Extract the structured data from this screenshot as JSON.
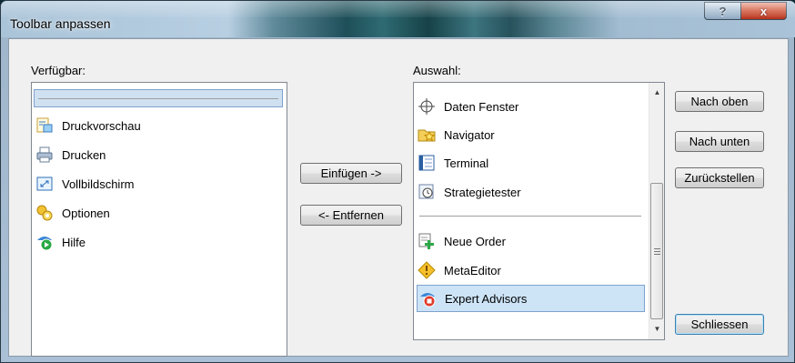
{
  "window": {
    "title": "Toolbar anpassen",
    "help_label": "?",
    "close_label": "x"
  },
  "available": {
    "label": "Verfügbar:",
    "items": [
      {
        "label": "Druckvorschau",
        "icon": "print-preview-icon"
      },
      {
        "label": "Drucken",
        "icon": "printer-icon"
      },
      {
        "label": "Vollbildschirm",
        "icon": "fullscreen-icon"
      },
      {
        "label": "Optionen",
        "icon": "options-icon"
      },
      {
        "label": "Hilfe",
        "icon": "help-icon"
      }
    ]
  },
  "buttons": {
    "insert": "Einfügen ->",
    "remove": "<- Entfernen",
    "move_up": "Nach oben",
    "move_down": "Nach unten",
    "reset": "Zurückstellen",
    "close": "Schliessen"
  },
  "selection": {
    "label": "Auswahl:",
    "items_top": [
      {
        "label": "Daten Fenster",
        "icon": "crosshair-icon"
      },
      {
        "label": "Navigator",
        "icon": "navigator-folder-icon"
      },
      {
        "label": "Terminal",
        "icon": "terminal-icon"
      },
      {
        "label": "Strategietester",
        "icon": "strategy-tester-icon"
      }
    ],
    "items_bottom": [
      {
        "label": "Neue Order",
        "icon": "new-order-icon"
      },
      {
        "label": "MetaEditor",
        "icon": "metaeditor-icon"
      },
      {
        "label": "Expert Advisors",
        "icon": "expert-advisors-icon",
        "selected": true
      }
    ]
  }
}
